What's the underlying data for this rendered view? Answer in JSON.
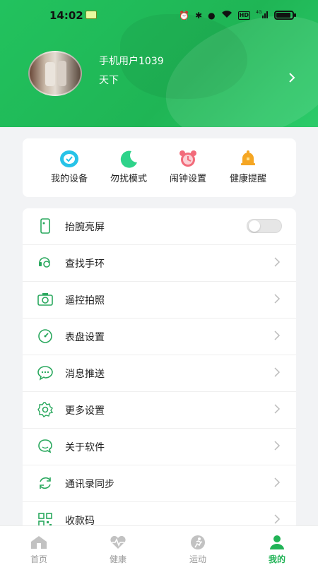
{
  "status_bar": {
    "time": "14:02",
    "network": "4G",
    "battery_level": 0.85
  },
  "profile": {
    "username": "手机用户1039",
    "location": "天下"
  },
  "quick_actions": [
    {
      "label": "我的设备",
      "icon": "watch-dial-icon",
      "color": "#27c3e8"
    },
    {
      "label": "勿扰模式",
      "icon": "moon-icon",
      "color": "#2ed38a"
    },
    {
      "label": "闹钟设置",
      "icon": "alarm-clock-icon",
      "color": "#f26b7a"
    },
    {
      "label": "健康提醒",
      "icon": "bell-icon",
      "color": "#f5a623"
    }
  ],
  "settings_list": [
    {
      "label": "抬腕亮屏",
      "icon": "wrist-raise-icon",
      "control": "toggle",
      "enabled": false
    },
    {
      "label": "查找手环",
      "icon": "find-band-icon",
      "control": "arrow"
    },
    {
      "label": "遥控拍照",
      "icon": "camera-icon",
      "control": "arrow"
    },
    {
      "label": "表盘设置",
      "icon": "watchface-icon",
      "control": "arrow"
    },
    {
      "label": "消息推送",
      "icon": "message-icon",
      "control": "arrow"
    },
    {
      "label": "更多设置",
      "icon": "gear-icon",
      "control": "arrow"
    },
    {
      "label": "关于软件",
      "icon": "info-icon",
      "control": "arrow"
    },
    {
      "label": "通讯录同步",
      "icon": "sync-icon",
      "control": "arrow"
    },
    {
      "label": "收款码",
      "icon": "qr-code-icon",
      "control": "arrow"
    }
  ],
  "tab_bar": {
    "active": "我的",
    "tabs": [
      {
        "label": "首页",
        "icon": "home-icon"
      },
      {
        "label": "健康",
        "icon": "heart-rate-icon"
      },
      {
        "label": "运动",
        "icon": "running-icon"
      },
      {
        "label": "我的",
        "icon": "person-icon"
      }
    ]
  },
  "colors": {
    "accent": "#21b356",
    "header_green": "#22c25e",
    "icon_green": "#2aa85e"
  }
}
